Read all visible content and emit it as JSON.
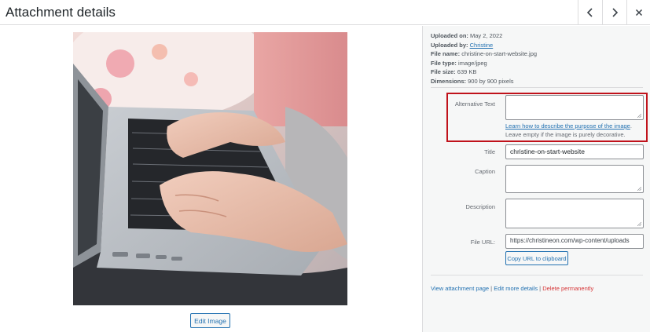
{
  "header": {
    "title": "Attachment details",
    "prev_icon": "chevron-left-icon",
    "next_icon": "chevron-right-icon",
    "close_icon": "close-icon"
  },
  "preview": {
    "edit_label": "Edit Image"
  },
  "details": {
    "uploaded_on_label": "Uploaded on:",
    "uploaded_on_value": "May 2, 2022",
    "uploaded_by_label": "Uploaded by:",
    "uploaded_by_value": "Christine",
    "file_name_label": "File name:",
    "file_name_value": "christine-on-start-website.jpg",
    "file_type_label": "File type:",
    "file_type_value": "image/jpeg",
    "file_size_label": "File size:",
    "file_size_value": "639 KB",
    "dimensions_label": "Dimensions:",
    "dimensions_value": "900 by 900 pixels"
  },
  "fields": {
    "alt_label": "Alternative Text",
    "alt_value": "",
    "alt_help_link": "Learn how to describe the purpose of the image",
    "alt_help_text": ". Leave empty if the image is purely decorative.",
    "title_label": "Title",
    "title_value": "christine-on-start-website",
    "caption_label": "Caption",
    "caption_value": "",
    "description_label": "Description",
    "description_value": "",
    "url_label": "File URL:",
    "url_value": "https://christineon.com/wp-content/uploads",
    "copy_label": "Copy URL to clipboard"
  },
  "actions": {
    "view": "View attachment page",
    "divider": "|",
    "edit": "Edit more details",
    "delete": "Delete permanently"
  },
  "colors": {
    "accent": "#2271b1",
    "highlight_border": "#c0121b",
    "danger": "#d63638"
  }
}
